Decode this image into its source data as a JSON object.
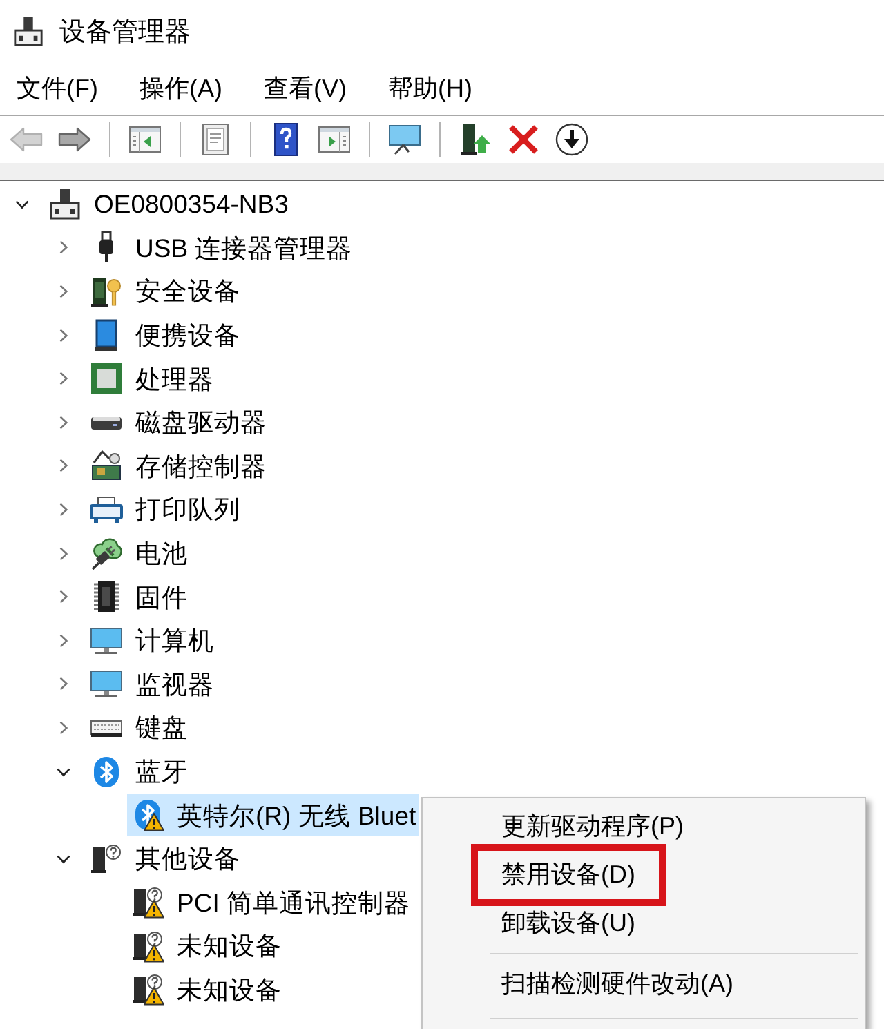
{
  "window": {
    "title": "设备管理器"
  },
  "menu_bar": [
    "文件(F)",
    "操作(A)",
    "查看(V)",
    "帮助(H)"
  ],
  "toolbar": [
    {
      "kind": "back",
      "disabled": true
    },
    {
      "kind": "forward",
      "disabled": false
    },
    {
      "kind": "separator"
    },
    {
      "kind": "console_tree",
      "disabled": false
    },
    {
      "kind": "separator"
    },
    {
      "kind": "properties",
      "disabled": false
    },
    {
      "kind": "separator"
    },
    {
      "kind": "help",
      "disabled": false
    },
    {
      "kind": "action_pane",
      "disabled": false
    },
    {
      "kind": "separator"
    },
    {
      "kind": "scan",
      "disabled": false
    },
    {
      "kind": "separator"
    },
    {
      "kind": "update_driver",
      "disabled": false
    },
    {
      "kind": "uninstall",
      "disabled": false
    },
    {
      "kind": "disable",
      "disabled": false
    }
  ],
  "tree": {
    "label": "OE0800354-NB3",
    "kind": "computer",
    "expanded": true,
    "selected": false,
    "warning": false,
    "children": [
      {
        "label": "USB 连接器管理器",
        "kind": "usb",
        "expanded": false,
        "selected": false,
        "warning": false
      },
      {
        "label": "安全设备",
        "kind": "security",
        "expanded": false,
        "selected": false,
        "warning": false
      },
      {
        "label": "便携设备",
        "kind": "portable",
        "expanded": false,
        "selected": false,
        "warning": false
      },
      {
        "label": "处理器",
        "kind": "processor",
        "expanded": false,
        "selected": false,
        "warning": false
      },
      {
        "label": "磁盘驱动器",
        "kind": "disk",
        "expanded": false,
        "selected": false,
        "warning": false
      },
      {
        "label": "存储控制器",
        "kind": "storage",
        "expanded": false,
        "selected": false,
        "warning": false
      },
      {
        "label": "打印队列",
        "kind": "print",
        "expanded": false,
        "selected": false,
        "warning": false
      },
      {
        "label": "电池",
        "kind": "battery",
        "expanded": false,
        "selected": false,
        "warning": false
      },
      {
        "label": "固件",
        "kind": "firmware",
        "expanded": false,
        "selected": false,
        "warning": false
      },
      {
        "label": "计算机",
        "kind": "pc",
        "expanded": false,
        "selected": false,
        "warning": false
      },
      {
        "label": "监视器",
        "kind": "monitor",
        "expanded": false,
        "selected": false,
        "warning": false
      },
      {
        "label": "键盘",
        "kind": "keyboard",
        "expanded": false,
        "selected": false,
        "warning": false
      },
      {
        "label": "蓝牙",
        "kind": "bluetooth",
        "expanded": true,
        "selected": false,
        "warning": false,
        "children": [
          {
            "label": "英特尔(R) 无线 Bluet",
            "kind": "bluetooth",
            "selected": true,
            "warning": true
          }
        ]
      },
      {
        "label": "其他设备",
        "kind": "other",
        "expanded": true,
        "selected": false,
        "warning": false,
        "children": [
          {
            "label": "PCI 简单通讯控制器",
            "kind": "unknown",
            "selected": false,
            "warning": true
          },
          {
            "label": "未知设备",
            "kind": "unknown",
            "selected": false,
            "warning": true
          },
          {
            "label": "未知设备",
            "kind": "unknown",
            "selected": false,
            "warning": true
          }
        ]
      }
    ]
  },
  "context_menu": {
    "items": [
      {
        "kind": "item",
        "label": "更新驱动程序(P)",
        "annotated": false
      },
      {
        "kind": "item",
        "label": "禁用设备(D)",
        "annotated": true
      },
      {
        "kind": "item",
        "label": "卸载设备(U)",
        "annotated": false
      },
      {
        "kind": "separator"
      },
      {
        "kind": "item",
        "label": "扫描检测硬件改动(A)",
        "annotated": false
      },
      {
        "kind": "separator"
      }
    ]
  }
}
